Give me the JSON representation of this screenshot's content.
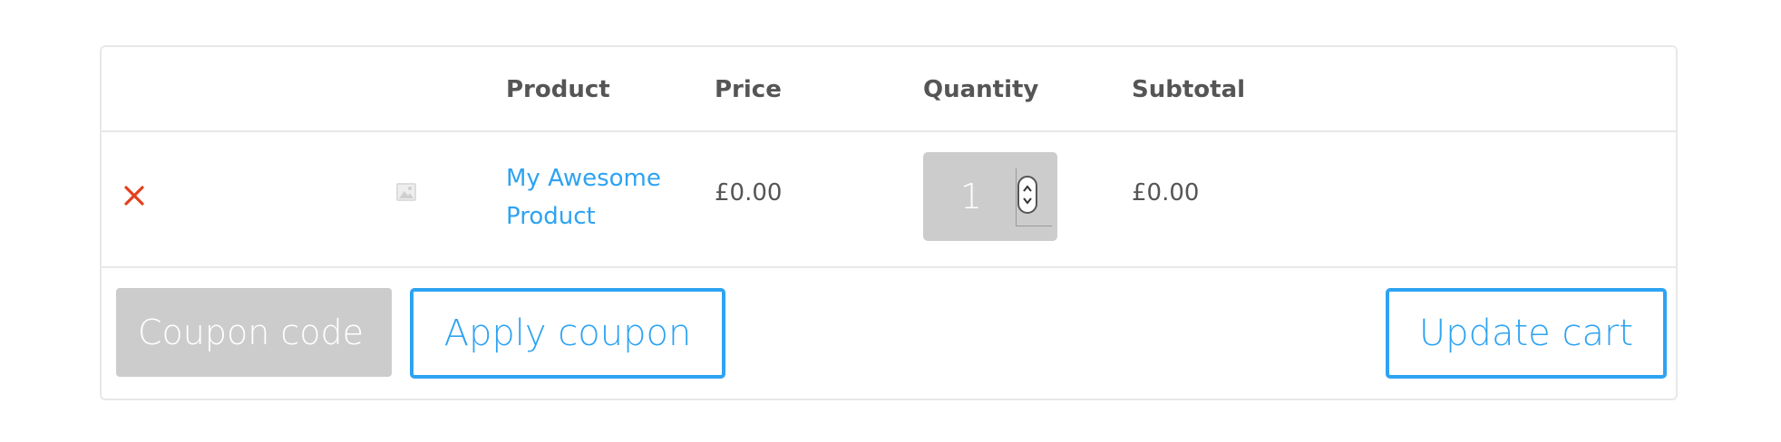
{
  "table": {
    "headers": {
      "product": "Product",
      "price": "Price",
      "quantity": "Quantity",
      "subtotal": "Subtotal"
    }
  },
  "items": [
    {
      "remove_icon": "x-icon",
      "thumbnail_icon": "image-placeholder-icon",
      "name": "My Awesome Product",
      "price": "£0.00",
      "quantity": "1",
      "subtotal": "£0.00"
    }
  ],
  "actions": {
    "coupon_placeholder": "Coupon code",
    "apply_coupon_label": "Apply coupon",
    "update_cart_label": "Update cart"
  },
  "colors": {
    "link": "#2ea3f2",
    "remove": "#e2401c",
    "input_bg": "#cccccc",
    "text": "#555555",
    "border": "#e8e8e8"
  }
}
